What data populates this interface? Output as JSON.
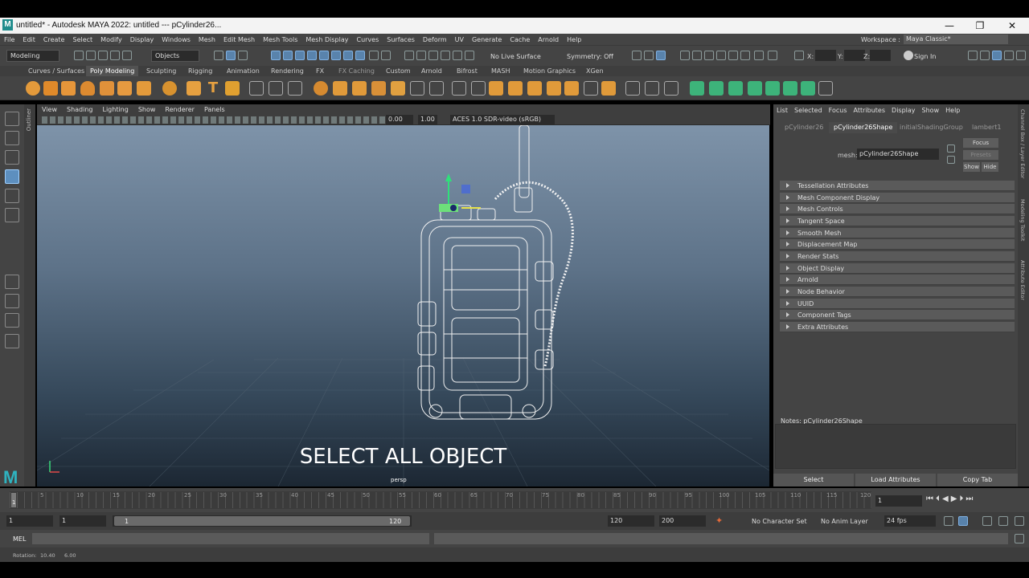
{
  "window": {
    "logo": "M",
    "title": "untitled* - Autodesk MAYA 2022: untitled   ---   pCylinder26...",
    "min_glyph": "—",
    "max_glyph": "❐",
    "close_glyph": "✕"
  },
  "menubar": {
    "items": [
      "File",
      "Edit",
      "Create",
      "Select",
      "Modify",
      "Display",
      "Windows",
      "Mesh",
      "Edit Mesh",
      "Mesh Tools",
      "Mesh Display",
      "Curves",
      "Surfaces",
      "Deform",
      "UV",
      "Generate",
      "Cache",
      "Arnold",
      "Help"
    ],
    "workspace_label": "Workspace :",
    "workspace_value": "Maya Classic*"
  },
  "statusline": {
    "mode": "Modeling",
    "selection_mode": "Objects",
    "live_surface": "No Live Surface",
    "symmetry": "Symmetry: Off",
    "x_label": "X:",
    "y_label": "Y:",
    "z_label": "Z:",
    "sign_in": "Sign In"
  },
  "shelf_tabs": [
    "Curves / Surfaces",
    "Poly Modeling",
    "Sculpting",
    "Rigging",
    "Animation",
    "Rendering",
    "FX",
    "FX Caching",
    "Custom",
    "Arnold",
    "Bifrost",
    "MASH",
    "Motion Graphics",
    "XGen"
  ],
  "shelf_active": "Poly Modeling",
  "outliner_label": "Outliner",
  "viewport": {
    "menu": [
      "View",
      "Shading",
      "Lighting",
      "Show",
      "Renderer",
      "Panels"
    ],
    "exposure": "0.00",
    "gamma": "1.00",
    "colorspace": "ACES 1.0 SDR-video (sRGB)",
    "caption": "SELECT ALL OBJECT",
    "camera": "persp",
    "axis_x": "x",
    "axis_y": "y"
  },
  "attribute_editor": {
    "menu": [
      "List",
      "Selected",
      "Focus",
      "Attributes",
      "Display",
      "Show",
      "Help"
    ],
    "tabs": [
      "pCylinder26",
      "pCylinder26Shape",
      "initialShadingGroup",
      "lambert1"
    ],
    "active_tab": "pCylinder26Shape",
    "mesh_label": "mesh:",
    "mesh_value": "pCylinder26Shape",
    "focus": "Focus",
    "presets": "Presets",
    "show": "Show",
    "hide": "Hide",
    "sections": [
      "Tessellation Attributes",
      "Mesh Component Display",
      "Mesh Controls",
      "Tangent Space",
      "Smooth Mesh",
      "Displacement Map",
      "Render Stats",
      "Object Display",
      "Arnold",
      "Node Behavior",
      "UUID",
      "Component Tags",
      "Extra Attributes"
    ],
    "notes_label": "Notes:  pCylinder26Shape",
    "buttons": [
      "Select",
      "Load Attributes",
      "Copy Tab"
    ]
  },
  "side_strip": [
    "Channel Box / Layer Editor",
    "Modeling Toolkit",
    "Attribute Editor"
  ],
  "timeslider": {
    "ticks": [
      "5",
      "10",
      "15",
      "20",
      "25",
      "30",
      "35",
      "40",
      "45",
      "50",
      "55",
      "60",
      "65",
      "70",
      "75",
      "80",
      "85",
      "90",
      "95",
      "100",
      "105",
      "110",
      "115",
      "120"
    ],
    "current_marker": "1",
    "current_frame": "1"
  },
  "range": {
    "start": "1",
    "start2": "1",
    "slider_start": "1",
    "slider_end": "120",
    "end": "120",
    "end2": "200",
    "character_set": "No Character Set",
    "anim_layer": "No Anim Layer",
    "fps": "24 fps"
  },
  "command_line": {
    "label": "MEL"
  },
  "helpline": {
    "label": "Rotation:",
    "v1": "10.40",
    "v2": "6.00"
  }
}
